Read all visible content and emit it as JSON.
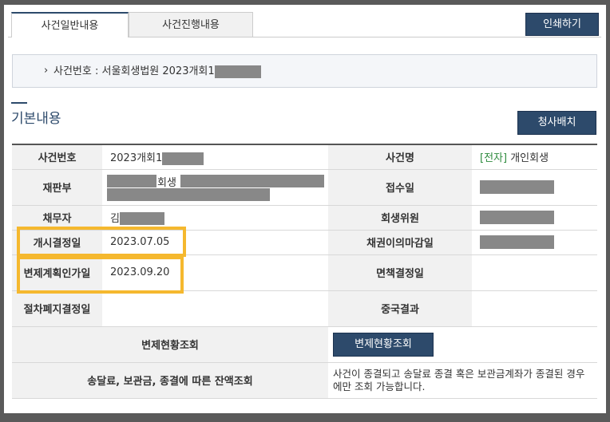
{
  "tabs": [
    {
      "label": "사건일반내용",
      "active": true
    },
    {
      "label": "사건진행내용",
      "active": false
    }
  ],
  "print_button": "인쇄하기",
  "case_number_line": {
    "bullet": "›",
    "text": "사건번호 : 서울회생법원 2023개회1"
  },
  "section_title": "기본내용",
  "assign_button": "청사배치",
  "table": {
    "case_number_label": "사건번호",
    "case_number_value": "2023개회1",
    "case_name_label": "사건명",
    "case_name_tag": "[전자]",
    "case_name_value": "개인회생",
    "court_label": "재판부",
    "court_value": "회생",
    "received_label": "접수일",
    "debtor_label": "채무자",
    "debtor_value": "김",
    "trustee_label": "회생위원",
    "start_decision_label": "개시결정일",
    "start_decision_value": "2023.07.05",
    "claim_deadline_label": "채권이의마감일",
    "plan_approval_label": "변제계획인가일",
    "plan_approval_value": "2023.09.20",
    "discharge_label": "면책결정일",
    "abolish_label": "절차폐지결정일",
    "termination_label": "중국결과",
    "repayment_status_label": "변제현황조회",
    "repayment_status_button": "변제현황조회",
    "balance_label": "송달료, 보관금, 종결에 따른 잔액조회",
    "balance_note": "사건이 종결되고 송달료 종결 혹은 보관금계좌가 종결된 경우에만 조회 가능합니다."
  },
  "colors": {
    "accent": "#2d4a6b",
    "highlight": "#f5b82e",
    "redaction": "#888888"
  }
}
